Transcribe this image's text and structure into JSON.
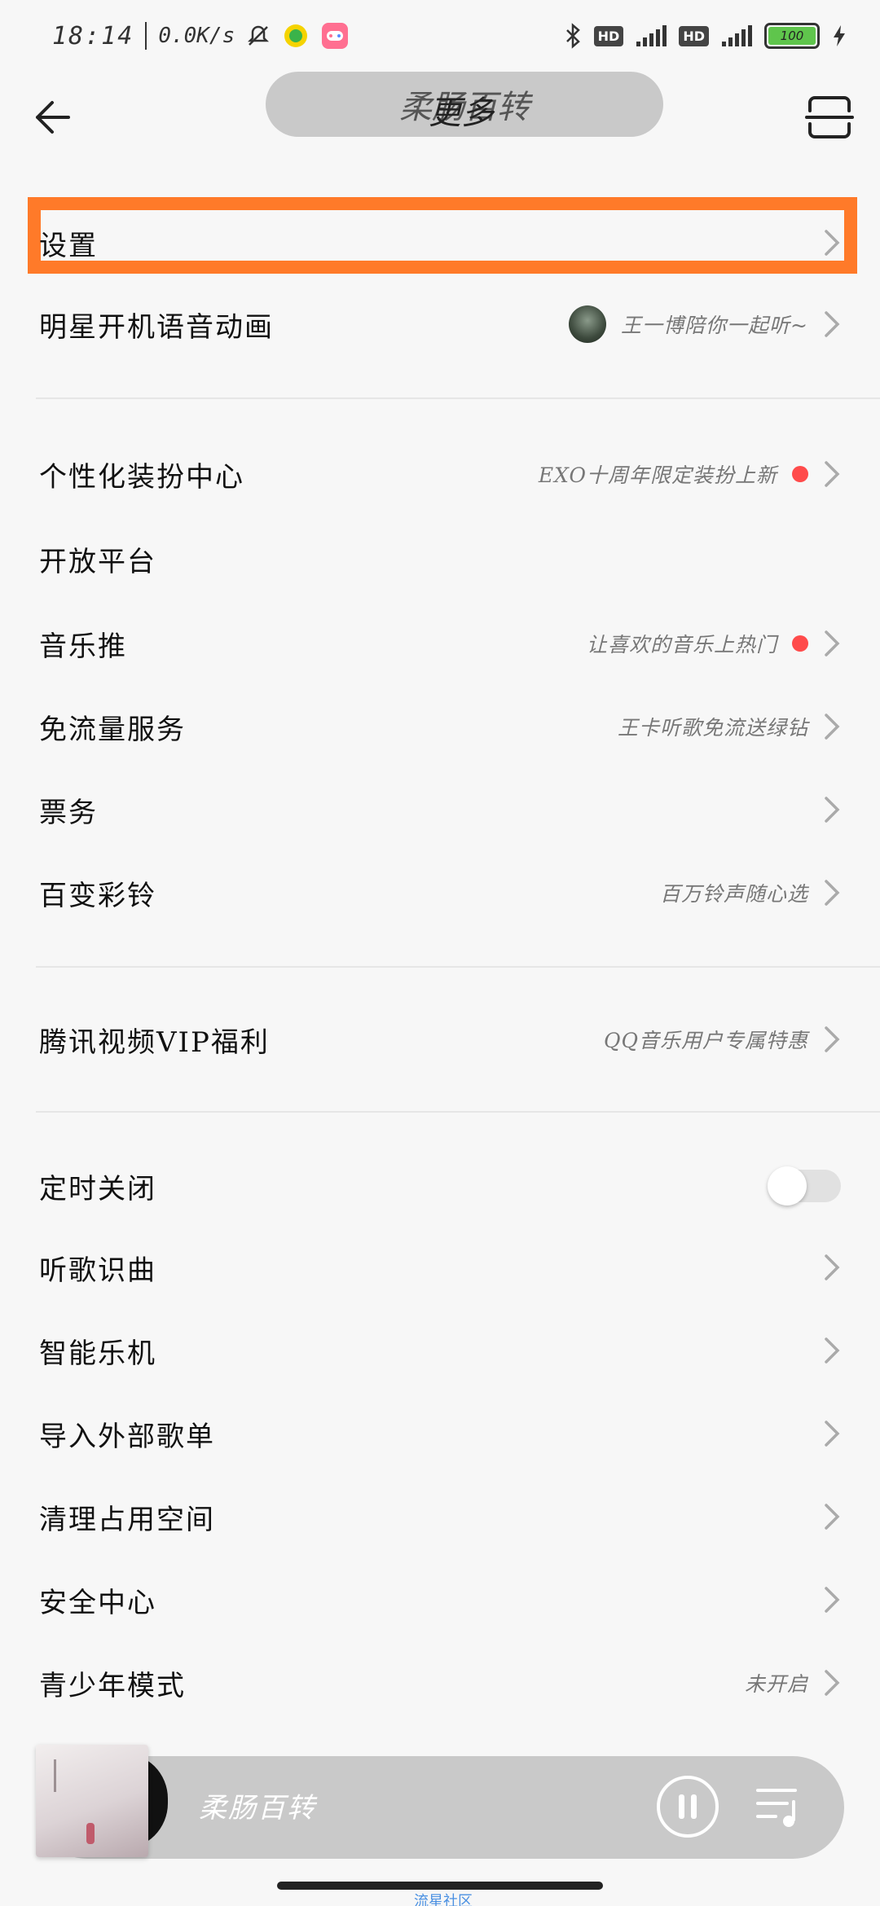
{
  "status_bar": {
    "time": "18:14",
    "speed": "0.0K/s",
    "battery": "100"
  },
  "header": {
    "title": "更多",
    "overlay_text": "柔肠百转"
  },
  "rows": [
    {
      "label": "设置",
      "note": ""
    },
    {
      "label": "明星开机语音动画",
      "note": "王一博陪你一起听~"
    },
    {
      "label": "个性化装扮中心",
      "note": "EXO十周年限定装扮上新"
    },
    {
      "label": "开放平台",
      "note": ""
    },
    {
      "label": "音乐推",
      "note": "让喜欢的音乐上热门"
    },
    {
      "label": "免流量服务",
      "note": "王卡听歌免流送绿钻"
    },
    {
      "label": "票务",
      "note": ""
    },
    {
      "label": "百变彩铃",
      "note": "百万铃声随心选"
    },
    {
      "label": "腾讯视频VIP福利",
      "note": "QQ音乐用户专属特惠"
    },
    {
      "label": "定时关闭",
      "note": ""
    },
    {
      "label": "听歌识曲",
      "note": ""
    },
    {
      "label": "智能乐机",
      "note": ""
    },
    {
      "label": "导入外部歌单",
      "note": ""
    },
    {
      "label": "清理占用空间",
      "note": ""
    },
    {
      "label": "安全中心",
      "note": ""
    },
    {
      "label": "青少年模式",
      "note": "未开启"
    }
  ],
  "player": {
    "title": "柔肠百转"
  },
  "bottom": {
    "tag": "流星社区"
  },
  "colors": {
    "highlight": "#ff7a29",
    "red_dot": "#ff4b4b",
    "battery": "#5fc54c"
  }
}
